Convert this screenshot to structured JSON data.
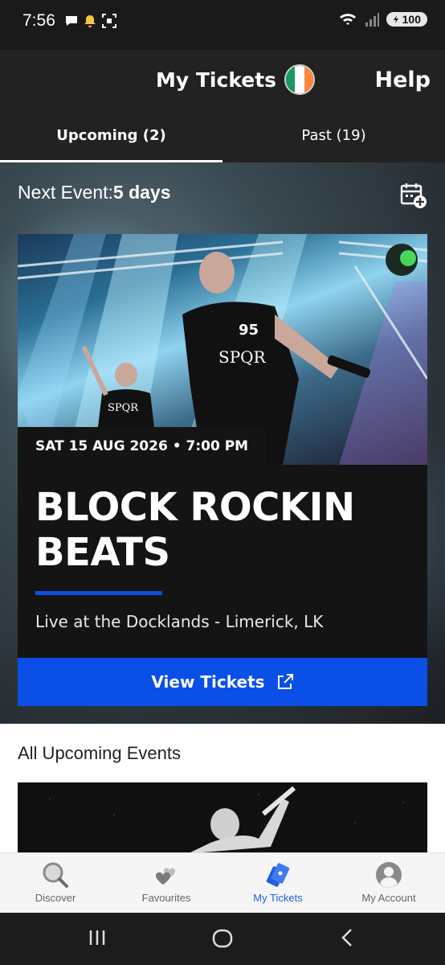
{
  "status_bar": {
    "time": "7:56",
    "battery": "100",
    "icons_left": [
      "chat-bubble-icon",
      "notification-bell-icon",
      "screenshot-icon"
    ],
    "icons_right": [
      "wifi-icon",
      "signal-icon",
      "battery-icon"
    ]
  },
  "header": {
    "title": "My Tickets",
    "help_label": "Help",
    "flag_colors": [
      "#169b62",
      "#ffffff",
      "#ff883e"
    ]
  },
  "tabs": [
    {
      "label": "Upcoming (2)",
      "active": true
    },
    {
      "label": "Past (19)",
      "active": false
    }
  ],
  "next_event": {
    "prefix": "Next Event:",
    "value": "5 days"
  },
  "event": {
    "date": "SAT 15 AUG 2026 • 7:00 PM",
    "title": "BLOCK ROCKIN BEATS",
    "venue": "Live at the Docklands - Limerick, LK",
    "cta_label": "View Tickets",
    "shirt_text_1": "95",
    "shirt_text_2": "SPQR",
    "shirt_text_3": "SPQR"
  },
  "all_upcoming": {
    "heading": "All Upcoming Events"
  },
  "bottom_nav": [
    {
      "label": "Discover",
      "icon": "search-icon",
      "active": false
    },
    {
      "label": "Favourites",
      "icon": "hearts-icon",
      "active": false
    },
    {
      "label": "My Tickets",
      "icon": "tickets-icon",
      "active": true
    },
    {
      "label": "My Account",
      "icon": "account-icon",
      "active": false
    }
  ],
  "colors": {
    "accent": "#0a4fe6",
    "nav_active": "#1f5fe0"
  }
}
